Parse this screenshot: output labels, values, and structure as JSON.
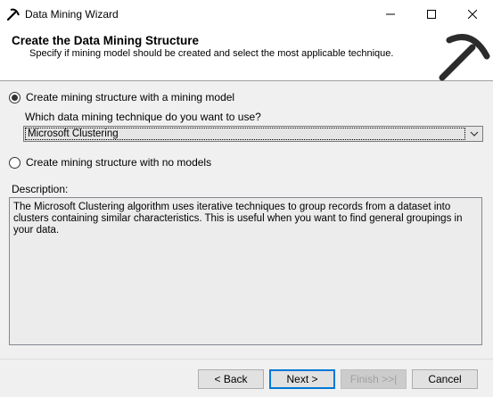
{
  "window": {
    "title": "Data Mining Wizard"
  },
  "titlebar": {
    "minimize": "minimize",
    "maximize": "maximize",
    "close": "close"
  },
  "header": {
    "title": "Create the Data Mining Structure",
    "subtitle": "Specify if mining model should be created and select the most applicable technique."
  },
  "options": {
    "with_model": {
      "label": "Create mining structure with a mining  model",
      "selected": true
    },
    "no_models": {
      "label": "Create mining structure with no models",
      "selected": false
    }
  },
  "technique": {
    "question": "Which data mining technique do you want to use?",
    "selected": "Microsoft Clustering"
  },
  "description": {
    "label": "Description:",
    "text": "The Microsoft Clustering algorithm uses iterative techniques to group records from a dataset into clusters containing similar characteristics. This is useful when you want to find general groupings in your data."
  },
  "buttons": {
    "back": "< Back",
    "next": "Next >",
    "finish": "Finish >>|",
    "cancel": "Cancel"
  },
  "colors": {
    "accent": "#0078d7",
    "header_bg": "#ffffff",
    "body_bg": "#f0f0f0"
  }
}
